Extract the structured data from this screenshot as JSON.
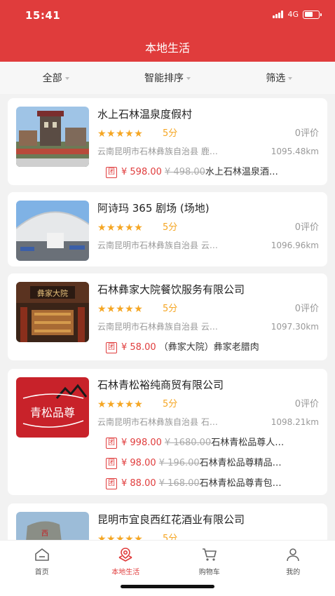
{
  "status_bar": {
    "time": "15:41",
    "network": "4G",
    "battery_level": 0.6
  },
  "nav": {
    "title": "本地生活"
  },
  "filters": [
    {
      "label": "全部",
      "active": true
    },
    {
      "label": "智能排序",
      "active": false
    },
    {
      "label": "筛选",
      "active": false
    }
  ],
  "stores": [
    {
      "name": "水上石林温泉度假村",
      "stars": "★★★★★",
      "score": "5分",
      "reviews": "0评价",
      "address": "云南昆明市石林彝族自治县 鹿…",
      "distance": "1095.48km",
      "image": "resort-photo",
      "deals": [
        {
          "tag": "团",
          "price": "¥ 598.00",
          "original": "¥ 498.00",
          "title": "水上石林温泉酒…"
        }
      ]
    },
    {
      "name": "阿诗玛 365 剧场 (场地)",
      "stars": "★★★★★",
      "score": "5分",
      "reviews": "0评价",
      "address": "云南昆明市石林彝族自治县 云…",
      "distance": "1096.96km",
      "image": "theater-photo",
      "deals": []
    },
    {
      "name": "石林彝家大院餐饮服务有限公司",
      "stars": "★★★★★",
      "score": "5分",
      "reviews": "0评价",
      "address": "云南昆明市石林彝族自治县 云…",
      "distance": "1097.30km",
      "image": "restaurant-photo",
      "deals": [
        {
          "tag": "团",
          "price": "¥ 58.00",
          "original": "",
          "title": "（彝家大院）彝家老腊肉"
        }
      ]
    },
    {
      "name": "石林青松裕纯商贸有限公司",
      "stars": "★★★★★",
      "score": "5分",
      "reviews": "0评价",
      "address": "云南昆明市石林彝族自治县 石…",
      "distance": "1098.21km",
      "image": "qingsong-logo",
      "logo_text": "青松品尊",
      "deals": [
        {
          "tag": "团",
          "price": "¥ 998.00",
          "original": "¥ 1680.00",
          "title": "石林青松品尊人…"
        },
        {
          "tag": "团",
          "price": "¥ 98.00",
          "original": "¥ 196.00",
          "title": "石林青松品尊精品…"
        },
        {
          "tag": "团",
          "price": "¥ 88.00",
          "original": "¥ 168.00",
          "title": "石林青松品尊青包…"
        }
      ]
    },
    {
      "name": "昆明市宜良西红花酒业有限公司",
      "stars": "★★★★★",
      "score": "5分",
      "reviews": "",
      "address": "",
      "distance": "",
      "image": "winery-photo",
      "deals": []
    }
  ],
  "tab_bar": [
    {
      "label": "首页",
      "icon": "home-icon",
      "active": false
    },
    {
      "label": "本地生活",
      "icon": "local-life-icon",
      "active": true
    },
    {
      "label": "购物车",
      "icon": "cart-icon",
      "active": false
    },
    {
      "label": "我的",
      "icon": "user-icon",
      "active": false
    }
  ],
  "colors": {
    "brand": "#e03c3c",
    "star": "#f5a623",
    "muted": "#999999"
  }
}
